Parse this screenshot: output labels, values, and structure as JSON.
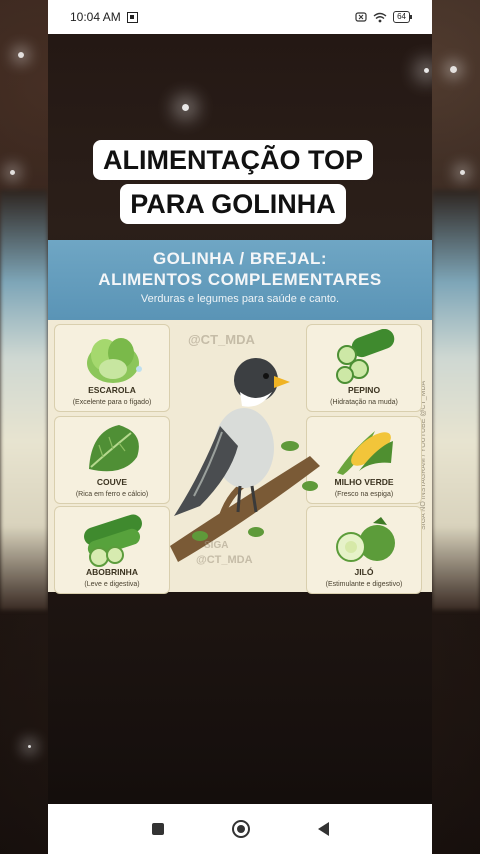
{
  "status_bar": {
    "time": "10:04 AM",
    "battery": "64"
  },
  "video": {
    "caption_line1": "ALIMENTAÇÃO TOP",
    "caption_line2": "PARA GOLINHA"
  },
  "infographic": {
    "title_line1": "GOLINHA / BREJAL:",
    "title_line2": "ALIMENTOS COMPLEMENTARES",
    "subtitle": "Verduras e legumes para saúde e canto.",
    "watermark_top": "@CT_MDA",
    "watermark_bottom_1": "SIGA",
    "watermark_bottom_2": "@CT_MDA",
    "side_text": "SIGA NO INSTAGRAM / YOUTUBE @CT_MDA",
    "foods": [
      {
        "name": "ESCAROLA",
        "desc": "(Excelente para o fígado)",
        "icon": "escarola-icon"
      },
      {
        "name": "PEPINO",
        "desc": "(Hidratação na muda)",
        "icon": "cucumber-icon"
      },
      {
        "name": "COUVE",
        "desc": "(Rica em ferro e cálcio)",
        "icon": "kale-icon"
      },
      {
        "name": "MILHO VERDE",
        "desc": "(Fresco na espiga)",
        "icon": "corn-icon"
      },
      {
        "name": "ABOBRINHA",
        "desc": "(Leve e digestiva)",
        "icon": "zucchini-icon"
      },
      {
        "name": "JILÓ",
        "desc": "(Estimulante e digestivo)",
        "icon": "jilo-icon"
      }
    ]
  },
  "nav": {
    "icons": [
      "recent-apps-icon",
      "home-icon",
      "back-icon"
    ]
  },
  "colors": {
    "header_blue": "#5a94b6",
    "card_bg": "#f1ead5",
    "leaf_green": "#5f9a3a"
  }
}
